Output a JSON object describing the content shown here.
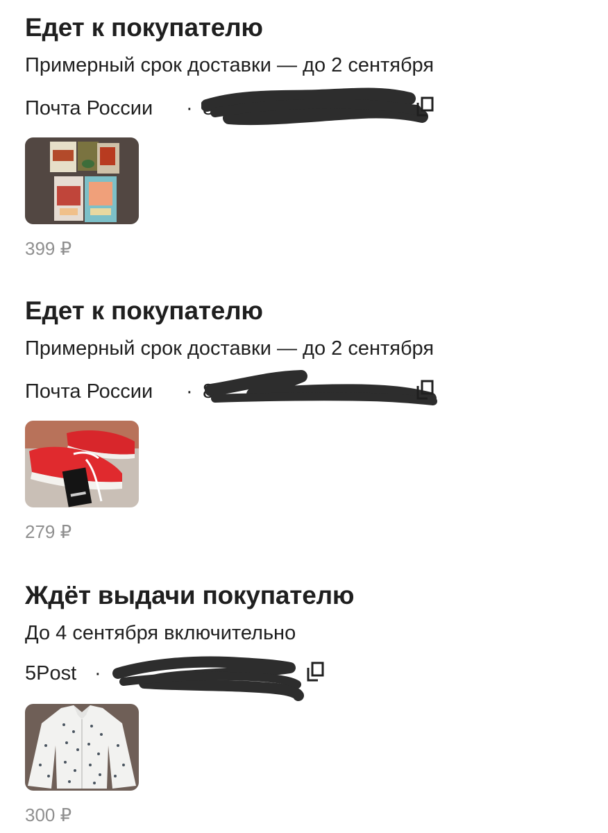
{
  "orders": [
    {
      "status": "Едет к покупателю",
      "eta": "Примерный срок доставки — до 2 сентября",
      "carrier": "Почта России",
      "separator": "·",
      "tracking_visible": "8",
      "price": "399 ₽",
      "thumbnail": "books-thumbnail"
    },
    {
      "status": "Едет к покупателю",
      "eta": "Примерный срок доставки — до 2 сентября",
      "carrier": "Почта России",
      "separator": "·",
      "tracking_visible": "8",
      "price": "279 ₽",
      "thumbnail": "red-sneakers-thumbnail"
    },
    {
      "status": "Ждёт выдачи покупателю",
      "eta": "До 4 сентября включительно",
      "carrier": "5Post",
      "separator": "·",
      "tracking_visible": "",
      "price": "300 ₽",
      "thumbnail": "blouse-thumbnail"
    }
  ],
  "icons": {
    "copy": "copy-icon"
  },
  "colors": {
    "text": "#1f1f1f",
    "price": "#8f8f8f",
    "redaction": "#2d2d2d"
  }
}
